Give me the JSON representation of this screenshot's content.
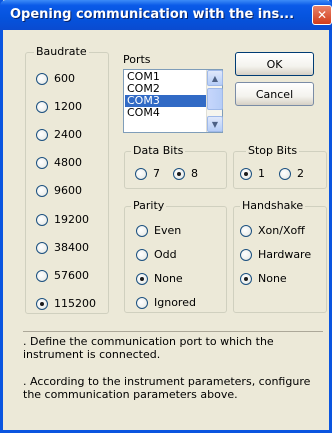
{
  "window": {
    "title": "Opening communication with the ins...",
    "close_glyph": "✕"
  },
  "baudrate": {
    "label": "Baudrate",
    "options": [
      "600",
      "1200",
      "2400",
      "4800",
      "9600",
      "19200",
      "38400",
      "57600",
      "115200"
    ],
    "selected": "115200"
  },
  "ports": {
    "label": "Ports",
    "items": [
      "COM1",
      "COM2",
      "COM3",
      "COM4"
    ],
    "selected": "COM3"
  },
  "buttons": {
    "ok": "OK",
    "cancel": "Cancel"
  },
  "data_bits": {
    "label": "Data Bits",
    "options": [
      "7",
      "8"
    ],
    "selected": "8"
  },
  "stop_bits": {
    "label": "Stop Bits",
    "options": [
      "1",
      "2"
    ],
    "selected": "1"
  },
  "parity": {
    "label": "Parity",
    "options": [
      "Even",
      "Odd",
      "None",
      "Ignored"
    ],
    "selected": "None"
  },
  "handshake": {
    "label": "Handshake",
    "options": [
      "Xon/Xoff",
      "Hardware",
      "None"
    ],
    "selected": "None"
  },
  "info": {
    "line1": ". Define the communication port to which the instrument is connected.",
    "line2": ". According to the instrument parameters, configure the communication parameters above."
  },
  "icons": {
    "close": "close-icon",
    "scroll_up": "chevron-up-icon",
    "scroll_down": "chevron-down-icon"
  }
}
